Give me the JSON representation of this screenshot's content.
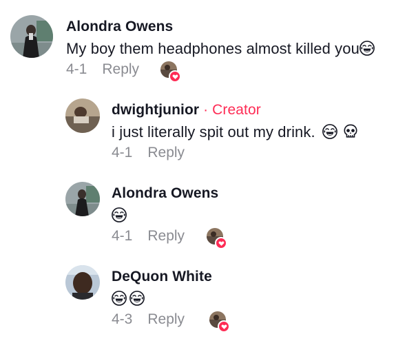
{
  "comments": [
    {
      "author": "Alondra Owens",
      "badge": "",
      "text": "My boy them headphones almost killed you",
      "emojis": [
        "laughing-crying"
      ],
      "date": "4-1",
      "reply_label": "Reply",
      "liked_by_creator": true
    },
    {
      "author": "dwightjunior",
      "badge": " · Creator",
      "text": "i just literally spit out my drink.",
      "emojis": [
        "laughing-crying",
        "skull"
      ],
      "date": "4-1",
      "reply_label": "Reply",
      "liked_by_creator": false
    },
    {
      "author": "Alondra Owens",
      "badge": "",
      "text": "",
      "emojis": [
        "laughing-crying"
      ],
      "date": "4-1",
      "reply_label": "Reply",
      "liked_by_creator": true
    },
    {
      "author": "DeQuon White",
      "badge": "",
      "text": "",
      "emojis": [
        "laughing-crying",
        "laughing-crying"
      ],
      "date": "4-3",
      "reply_label": "Reply",
      "liked_by_creator": true
    }
  ],
  "colors": {
    "creator_badge": "#fe2c55",
    "meta_text": "#8a8b91",
    "like_heart": "#fe2c55"
  }
}
